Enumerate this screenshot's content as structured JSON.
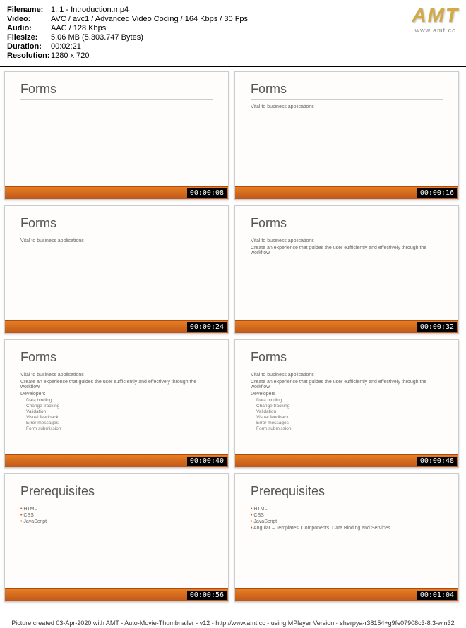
{
  "meta": {
    "filename_label": "Filename:",
    "filename": "1. 1 - Introduction.mp4",
    "video_label": "Video:",
    "video": "AVC / avc1 / Advanced Video Coding / 164 Kbps / 30 Fps",
    "audio_label": "Audio:",
    "audio": "AAC / 128 Kbps",
    "filesize_label": "Filesize:",
    "filesize": "5.06 MB (5.303.747 Bytes)",
    "duration_label": "Duration:",
    "duration": "00:02:21",
    "resolution_label": "Resolution:",
    "resolution": "1280 x 720"
  },
  "logo": {
    "text": "AMT",
    "url": "www.amt.cc"
  },
  "slides": {
    "title_forms": "Forms",
    "title_prereq": "Prerequisites",
    "vital": "Vital to business applications",
    "create": "Create an experience that guides the user e1fficiently and effectively through the workflow",
    "devs": "Developers",
    "items": [
      "Data binding",
      "Change tracking",
      "Validation",
      "Visual feedback",
      "Error messages",
      "Form submission"
    ],
    "prereq": [
      "HTML",
      "CSS",
      "JavaScript"
    ],
    "angular": "Angular – Templates, Components, Data Binding and Services"
  },
  "ts": [
    "00:00:08",
    "00:00:16",
    "00:00:24",
    "00:00:32",
    "00:00:40",
    "00:00:48",
    "00:00:56",
    "00:01:04"
  ],
  "footer": "Picture created 03-Apr-2020 with AMT - Auto-Movie-Thumbnailer - v12 - http://www.amt.cc - using MPlayer Version - sherpya-r38154+g9fe07908c3-8.3-win32"
}
